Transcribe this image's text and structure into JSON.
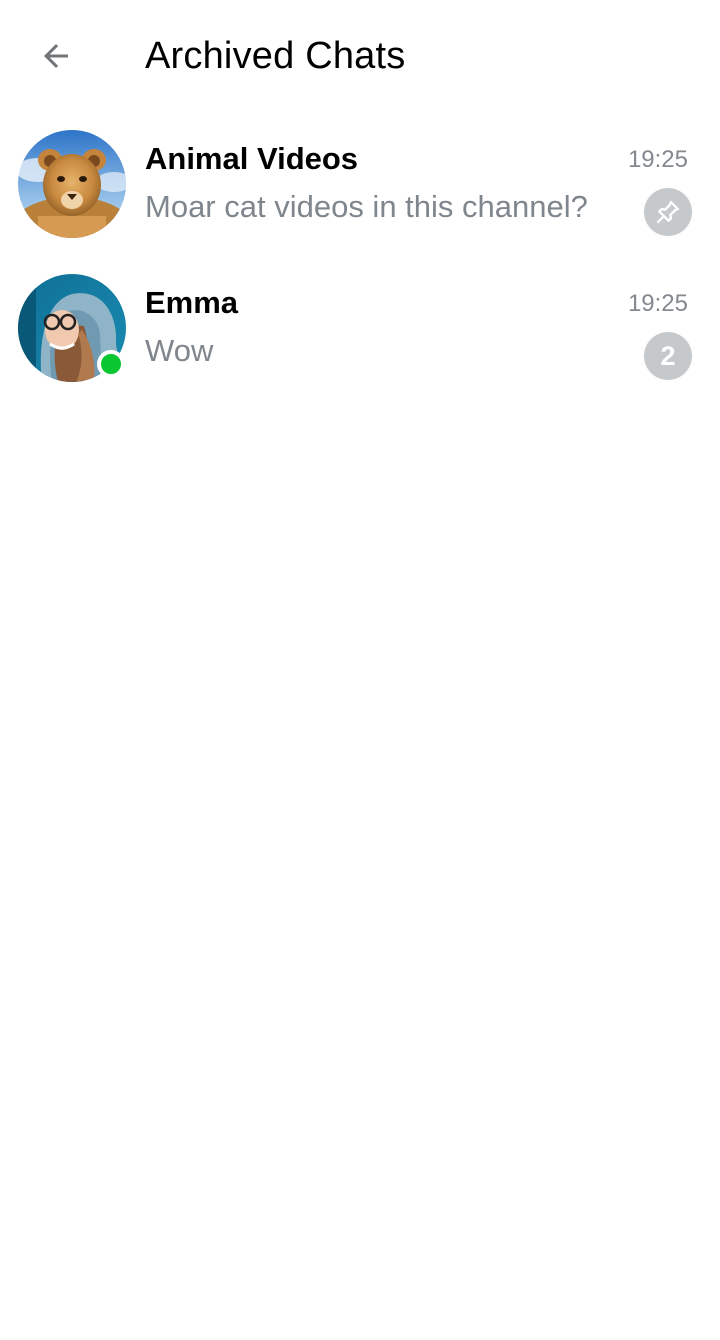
{
  "header": {
    "title": "Archived Chats",
    "back_icon": "arrow-left-icon"
  },
  "chats": [
    {
      "name": "Animal Videos",
      "preview": "Moar cat videos in this channel?",
      "time": "19:25",
      "pinned": true,
      "pin_icon": "pin-icon",
      "avatar": "lion-cub-photo"
    },
    {
      "name": "Emma",
      "preview": "Wow",
      "time": "19:25",
      "unread_count": "2",
      "online": true,
      "avatar": "woman-in-hood-photo"
    }
  ],
  "colors": {
    "online": "#0ac630",
    "badge": "#c5c9cc",
    "secondary_text": "#7f868d"
  }
}
